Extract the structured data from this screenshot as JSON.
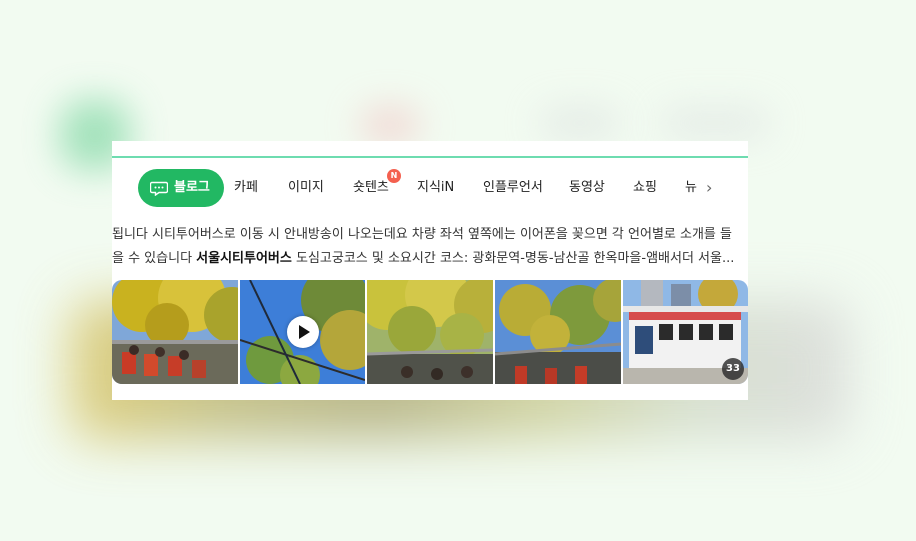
{
  "tabs": {
    "items": [
      {
        "label": "블로그",
        "active": true
      },
      {
        "label": "카페"
      },
      {
        "label": "이미지"
      },
      {
        "label": "숏텐츠",
        "badge": "N"
      },
      {
        "label": "지식iN"
      },
      {
        "label": "인플루언서"
      },
      {
        "label": "동영상"
      },
      {
        "label": "쇼핑"
      },
      {
        "label": "뉴"
      }
    ],
    "prev_icon": "chevron-left-icon",
    "next_icon": "chevron-right-icon"
  },
  "snippet": {
    "line1": "됩니다 시티투어버스로 이동 시 안내방송이 나오는데요 차량 좌석 옆쪽에는 이어폰을 꽂으면 각 언어별로 소개를 들",
    "line2_prefix": "을 수 있습니다 ",
    "line2_bold": "서울시티투어버스",
    "line2_suffix": " 도심고궁코스 및 소요시간 코스: 광화문역-명동-남산골 한옥마을-앰배서더 서울..."
  },
  "thumbnails": {
    "play_icon": "play-icon",
    "count": "33"
  },
  "colors": {
    "accent": "#22b863",
    "topline": "#6edcb0",
    "badge": "#f4604f"
  }
}
